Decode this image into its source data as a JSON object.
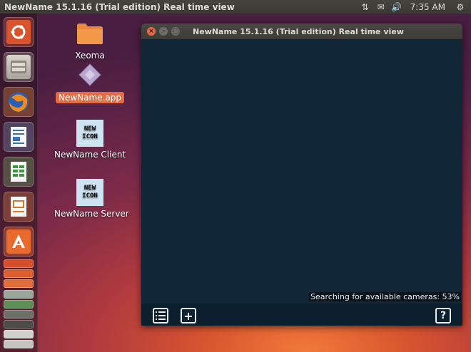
{
  "topbar": {
    "title": "NewName 15.1.16 (Trial edition) Real time view",
    "network_icon": "⇅",
    "mail_icon": "✉",
    "volume_icon": "🔊",
    "clock": "7:35 AM",
    "gear_icon": "⚙"
  },
  "desktop": {
    "icons": [
      {
        "label": "Xeoma"
      },
      {
        "label": "NewName.app"
      },
      {
        "label": "NewName Client",
        "badge_line1": "NEW",
        "badge_line2": "ICON"
      },
      {
        "label": "NewName Server",
        "badge_line1": "NEW",
        "badge_line2": "ICON"
      }
    ]
  },
  "window": {
    "title": "NewName 15.1.16 (Trial edition) Real time view",
    "close_glyph": "×",
    "minimize_glyph": "–",
    "maximize_glyph": "□",
    "status": "Searching for available cameras: 53%",
    "search_progress_percent": 53,
    "help_label": "?",
    "add_label": "+"
  },
  "colors": {
    "accent": "#e36c45",
    "window_bg": "#102636"
  }
}
